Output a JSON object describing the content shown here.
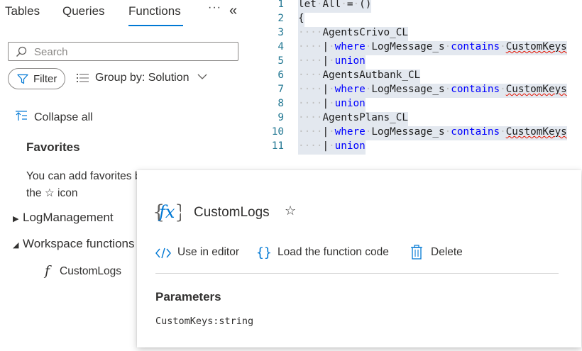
{
  "tabs": [
    {
      "label": "Tables"
    },
    {
      "label": "Queries"
    },
    {
      "label": "Functions",
      "active": true
    }
  ],
  "more_label": "···",
  "collapse_pane_label": "«",
  "search": {
    "placeholder": "Search"
  },
  "filter": {
    "label": "Filter"
  },
  "groupby": {
    "label": "Group by: Solution"
  },
  "collapse_all": {
    "label": "Collapse all"
  },
  "favorites": {
    "title": "Favorites",
    "text_line1": "You can add favorites by clicking on",
    "text_line2": "the ☆ icon"
  },
  "tree": {
    "log_management": "LogManagement",
    "workspace_functions": "Workspace functions",
    "custom_logs": "CustomLogs"
  },
  "editor": {
    "lines": [
      {
        "n": "1",
        "tokens": [
          [
            "t",
            "let"
          ],
          [
            "d",
            "·"
          ],
          [
            "t",
            "All"
          ],
          [
            "d",
            "·"
          ],
          [
            "t",
            "="
          ],
          [
            "d",
            "·"
          ],
          [
            "t",
            "()"
          ]
        ]
      },
      {
        "n": "2",
        "tokens": [
          [
            "t",
            "{"
          ]
        ]
      },
      {
        "n": "3",
        "tokens": [
          [
            "d",
            "····"
          ],
          [
            "t",
            "AgentsCrivo_CL"
          ]
        ]
      },
      {
        "n": "4",
        "tokens": [
          [
            "d",
            "····"
          ],
          [
            "t",
            "|"
          ],
          [
            "d",
            "·"
          ],
          [
            "k",
            "where"
          ],
          [
            "d",
            "·"
          ],
          [
            "t",
            "LogMessage_s"
          ],
          [
            "d",
            "·"
          ],
          [
            "k",
            "contains"
          ],
          [
            "d",
            "·"
          ],
          [
            "s",
            "CustomKeys"
          ]
        ]
      },
      {
        "n": "5",
        "tokens": [
          [
            "d",
            "····"
          ],
          [
            "t",
            "|"
          ],
          [
            "d",
            "·"
          ],
          [
            "k",
            "union"
          ]
        ]
      },
      {
        "n": "6",
        "tokens": [
          [
            "d",
            "····"
          ],
          [
            "t",
            "AgentsAutbank_CL"
          ]
        ]
      },
      {
        "n": "7",
        "tokens": [
          [
            "d",
            "····"
          ],
          [
            "t",
            "|"
          ],
          [
            "d",
            "·"
          ],
          [
            "k",
            "where"
          ],
          [
            "d",
            "·"
          ],
          [
            "t",
            "LogMessage_s"
          ],
          [
            "d",
            "·"
          ],
          [
            "k",
            "contains"
          ],
          [
            "d",
            "·"
          ],
          [
            "s",
            "CustomKeys"
          ]
        ]
      },
      {
        "n": "8",
        "tokens": [
          [
            "d",
            "····"
          ],
          [
            "t",
            "|"
          ],
          [
            "d",
            "·"
          ],
          [
            "k",
            "union"
          ]
        ]
      },
      {
        "n": "9",
        "tokens": [
          [
            "d",
            "····"
          ],
          [
            "t",
            "AgentsPlans_CL"
          ]
        ]
      },
      {
        "n": "10",
        "tokens": [
          [
            "d",
            "····"
          ],
          [
            "t",
            "|"
          ],
          [
            "d",
            "·"
          ],
          [
            "k",
            "where"
          ],
          [
            "d",
            "·"
          ],
          [
            "t",
            "LogMessage_s"
          ],
          [
            "d",
            "·"
          ],
          [
            "k",
            "contains"
          ],
          [
            "d",
            "·"
          ],
          [
            "s",
            "CustomKeys"
          ]
        ]
      },
      {
        "n": "11",
        "tokens": [
          [
            "d",
            "····"
          ],
          [
            "t",
            "|"
          ],
          [
            "d",
            "·"
          ],
          [
            "k",
            "union"
          ]
        ]
      }
    ]
  },
  "card": {
    "fx_label": "{fx}",
    "title": "CustomLogs",
    "star": "☆",
    "actions": {
      "use_in_editor": "Use in editor",
      "load_code": "Load the function code",
      "delete": "Delete"
    },
    "params_title": "Parameters",
    "params_value": "CustomKeys:string"
  },
  "colors": {
    "accent": "#0078d4",
    "keyword": "#0000ff",
    "line_number": "#237893",
    "selection": "#e3e8ef"
  }
}
